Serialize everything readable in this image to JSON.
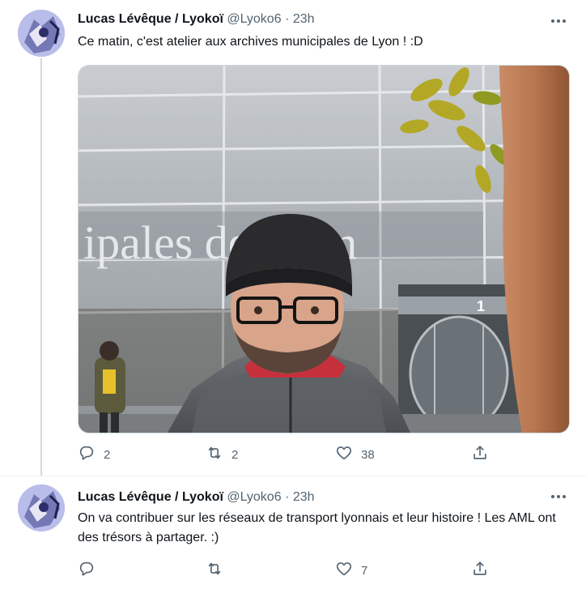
{
  "tweets": [
    {
      "name": "Lucas Lévêque / Lyokoï",
      "handle": "@Lyoko6",
      "separator": "·",
      "time": "23h",
      "text": "Ce matin, c'est atelier aux archives municipales de Lyon ! :D",
      "photo_sign": "ipales de Lyon",
      "door_number": "1",
      "replies": "2",
      "retweets": "2",
      "likes": "38"
    },
    {
      "name": "Lucas Lévêque / Lyokoï",
      "handle": "@Lyoko6",
      "separator": "·",
      "time": "23h",
      "text": "On va contribuer sur les réseaux de transport lyonnais et leur histoire ! Les AML ont des trésors à partager. :)",
      "replies": "",
      "retweets": "",
      "likes": "7"
    }
  ],
  "colors": {
    "text_primary": "#0f1419",
    "text_secondary": "#536471",
    "divider": "#eff3f4",
    "thread_line": "#cfd9de"
  },
  "icons": [
    "more-icon",
    "reply-icon",
    "retweet-icon",
    "like-icon",
    "share-icon"
  ]
}
